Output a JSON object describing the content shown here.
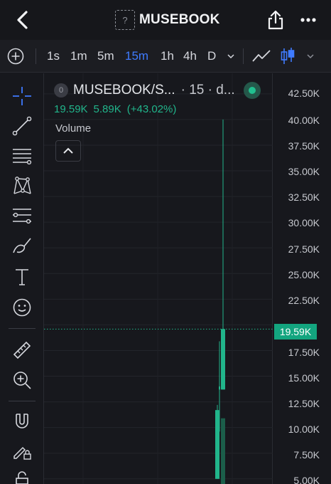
{
  "header": {
    "title": "MUSEBOOK",
    "token_icon_glyph": "?"
  },
  "toolbar": {
    "intervals": [
      "1s",
      "1m",
      "5m",
      "15m",
      "1h",
      "4h",
      "D"
    ],
    "active_interval": "15m"
  },
  "legend": {
    "badge": "0",
    "pair": "MUSEBOOK/S...",
    "meta": "· 15 · d...",
    "price": "19.59K",
    "change": "5.89K",
    "change_pct": "(+43.02%)",
    "volume_label": "Volume"
  },
  "axis": {
    "labels": [
      "42.50K",
      "40.00K",
      "37.50K",
      "35.00K",
      "32.50K",
      "30.00K",
      "27.50K",
      "25.00K",
      "22.50K",
      "17.50K",
      "15.00K",
      "12.50K",
      "10.00K",
      "7.50K",
      "5.00K"
    ],
    "current_price": "19.59K"
  },
  "colors": {
    "up": "#21b58b",
    "accent": "#3f7bff",
    "background": "#17181d"
  },
  "chart_data": {
    "type": "candlestick",
    "y_unit": "K",
    "ylim": [
      4.5,
      44.5
    ],
    "candles": [
      {
        "open": 5.0,
        "high": 12.2,
        "low": 5.0,
        "close": 11.7
      },
      {
        "open": 14.0,
        "high": 18.4,
        "low": 9.6,
        "close": 13.7
      },
      {
        "open": 13.7,
        "high": 40.0,
        "low": 13.7,
        "close": 19.59
      }
    ],
    "volume_bars": [
      0.0,
      0.0,
      0.16
    ]
  }
}
